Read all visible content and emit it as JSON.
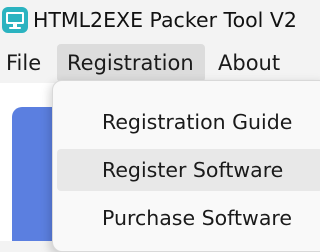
{
  "window": {
    "title": "HTML2EXE Packer Tool V2",
    "app_icon": "monitor-app-icon"
  },
  "menubar": {
    "items": [
      {
        "label": "File"
      },
      {
        "label": "Registration",
        "active": true
      },
      {
        "label": "About"
      }
    ]
  },
  "dropdown": {
    "items": [
      {
        "label": "Registration Guide"
      },
      {
        "label": "Register Software",
        "highlighted": true
      },
      {
        "label": "Purchase Software"
      }
    ]
  },
  "colors": {
    "accent_panel": "#5b7fe0",
    "icon_teal": "#2bb3c0",
    "menu_active_bg": "#dcdcdc",
    "hover_bg": "#e8e8e8"
  }
}
